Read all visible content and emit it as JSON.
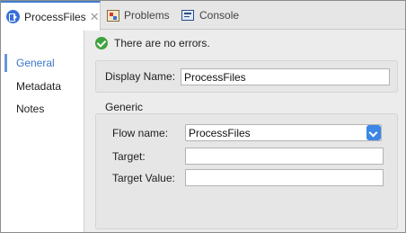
{
  "tabs": [
    {
      "label": "ProcessFiles",
      "icon": "flow-icon",
      "active": true
    },
    {
      "label": "Problems",
      "icon": "problems-icon",
      "active": false
    },
    {
      "label": "Console",
      "icon": "console-icon",
      "active": false
    }
  ],
  "tab_close_glyph": "✕",
  "sidenav": {
    "items": [
      {
        "label": "General",
        "active": true
      },
      {
        "label": "Metadata",
        "active": false
      },
      {
        "label": "Notes",
        "active": false
      }
    ]
  },
  "status": {
    "text": "There are no errors.",
    "icon": "check-icon"
  },
  "display_name": {
    "label": "Display Name:",
    "value": "ProcessFiles"
  },
  "generic": {
    "title": "Generic",
    "flow_name": {
      "label": "Flow name:",
      "value": "ProcessFiles"
    },
    "target": {
      "label": "Target:",
      "value": ""
    },
    "target_value": {
      "label": "Target Value:",
      "value": ""
    }
  },
  "colors": {
    "accent": "#3a78c9",
    "select_button": "#3b86e6",
    "success": "#3fa33f"
  }
}
